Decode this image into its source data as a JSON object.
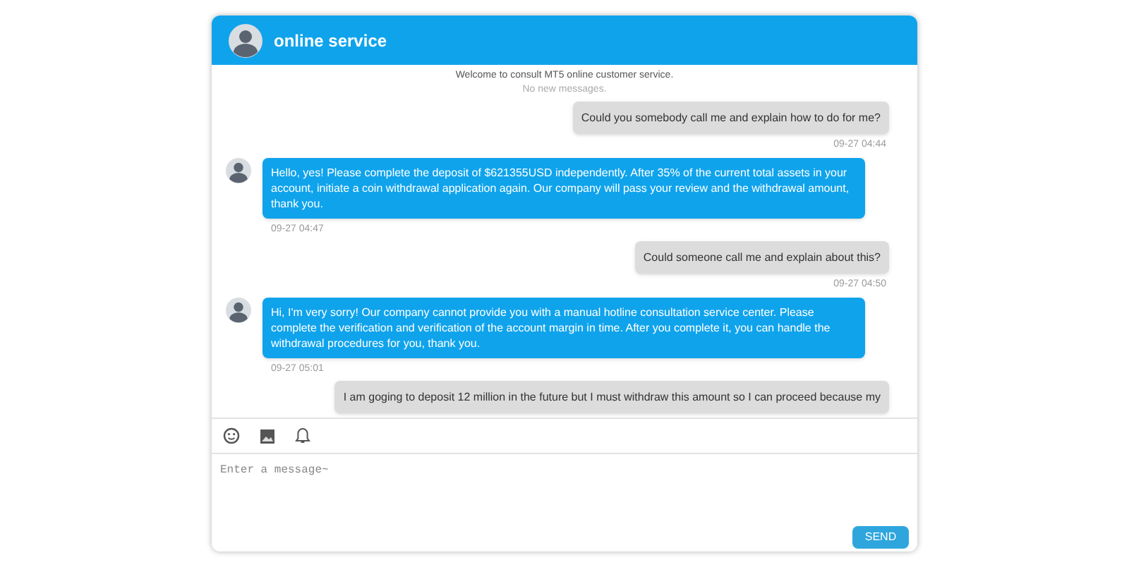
{
  "header": {
    "title": "online service"
  },
  "notices": [
    "Welcome to consult MT5 online customer service.",
    "No new messages."
  ],
  "messages": [
    {
      "kind": "user",
      "text": "Could you somebody call me and explain how to do for me?",
      "time": "09-27 04:44"
    },
    {
      "kind": "agent",
      "text": "Hello, yes! Please complete the deposit of $621355USD independently. After 35% of the current total assets in your account, initiate a coin withdrawal application again. Our company will pass your review and the withdrawal amount, thank you.",
      "time": "09-27 04:47"
    },
    {
      "kind": "user",
      "text": "Could someone call me and explain about this?",
      "time": "09-27 04:50"
    },
    {
      "kind": "agent",
      "text": "Hi, I'm very sorry! Our company cannot provide you with a manual hotline consultation service center. Please complete the verification and verification of the account margin in time. After you complete it, you can handle the withdrawal procedures for you, thank you.",
      "time": "09-27 05:01"
    },
    {
      "kind": "user",
      "text": "I am goging to deposit 12 million in the future but I must withdraw this amount so I can proceed because my"
    }
  ],
  "composer": {
    "placeholder": "Enter a message~",
    "send": "SEND"
  }
}
